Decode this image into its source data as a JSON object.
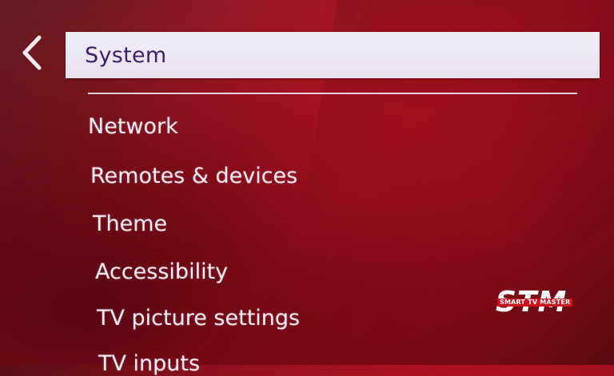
{
  "header": {
    "title": "System",
    "back_icon": "chevron-left-icon"
  },
  "menu": {
    "items": [
      {
        "label": "Network"
      },
      {
        "label": "Remotes & devices"
      },
      {
        "label": "Theme"
      },
      {
        "label": "Accessibility"
      },
      {
        "label": "TV picture settings"
      },
      {
        "label": "TV inputs"
      }
    ]
  },
  "watermark": {
    "logo_big": "STM",
    "logo_small": "SMART TV MASTER"
  },
  "colors": {
    "background": "#9a0e1c",
    "header_bar": "#ece8f2",
    "header_text": "#3f1d6b",
    "menu_text": "#f6ecf4"
  }
}
